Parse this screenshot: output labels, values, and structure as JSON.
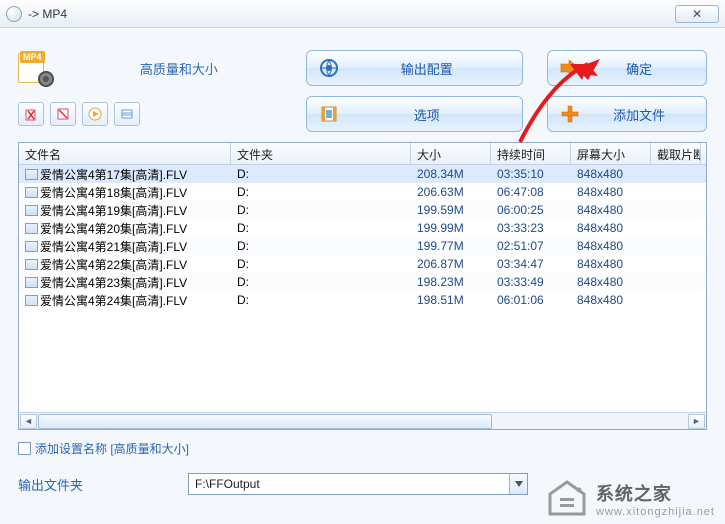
{
  "window": {
    "title": "-> MP4",
    "close_glyph": "✕"
  },
  "top": {
    "mp4_tag": "MP4",
    "quality_label": "高质量和大小",
    "output_config": "输出配置",
    "ok": "确定",
    "options": "选项",
    "add_files": "添加文件"
  },
  "table": {
    "headers": {
      "name": "文件名",
      "folder": "文件夹",
      "size": "大小",
      "duration": "持续时间",
      "dim": "屏幕大小",
      "clip": "截取片断"
    },
    "rows": [
      {
        "name": "爱情公寓4第17集[高清].FLV",
        "folder": "D:",
        "size": "208.34M",
        "duration": "03:35:10",
        "dim": "848x480"
      },
      {
        "name": "爱情公寓4第18集[高清].FLV",
        "folder": "D:",
        "size": "206.63M",
        "duration": "06:47:08",
        "dim": "848x480"
      },
      {
        "name": "爱情公寓4第19集[高清].FLV",
        "folder": "D:",
        "size": "199.59M",
        "duration": "06:00:25",
        "dim": "848x480"
      },
      {
        "name": "爱情公寓4第20集[高清].FLV",
        "folder": "D:",
        "size": "199.99M",
        "duration": "03:33:23",
        "dim": "848x480"
      },
      {
        "name": "爱情公寓4第21集[高清].FLV",
        "folder": "D:",
        "size": "199.77M",
        "duration": "02:51:07",
        "dim": "848x480"
      },
      {
        "name": "爱情公寓4第22集[高清].FLV",
        "folder": "D:",
        "size": "206.87M",
        "duration": "03:34:47",
        "dim": "848x480"
      },
      {
        "name": "爱情公寓4第23集[高清].FLV",
        "folder": "D:",
        "size": "198.23M",
        "duration": "03:33:49",
        "dim": "848x480"
      },
      {
        "name": "爱情公寓4第24集[高清].FLV",
        "folder": "D:",
        "size": "198.51M",
        "duration": "06:01:06",
        "dim": "848x480"
      }
    ]
  },
  "addset": {
    "label": "添加设置名称 [高质量和大小]"
  },
  "output": {
    "label": "输出文件夹",
    "value": "F:\\FFOutput"
  },
  "watermark": {
    "line1": "系统之家",
    "line2": "www.xitongzhijia.net"
  },
  "colors": {
    "accent": "#2a66b3",
    "arrow": "#e51a1a"
  }
}
